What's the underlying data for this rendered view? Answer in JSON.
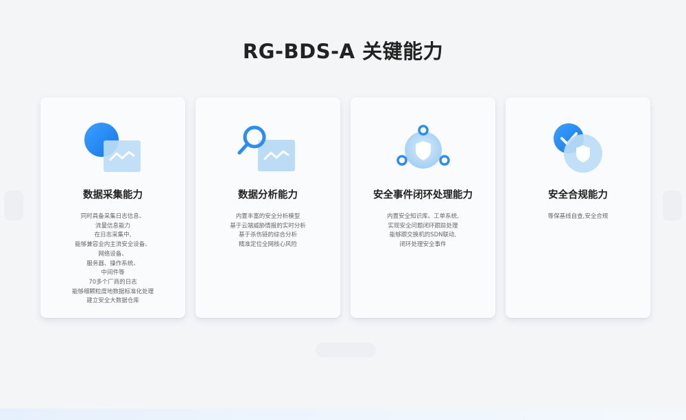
{
  "page": {
    "title": "RG-BDS-A 关键能力"
  },
  "cards": [
    {
      "title": "数据采集能力",
      "icon": "data-collection-icon",
      "desc": [
        "同时具备采集日志信息、",
        "流量信息能力",
        "在日志采集中,",
        "能够兼容业内主流安全设备、",
        "网络设备、",
        "服务器、操作系统、",
        "中间件等",
        "70多个厂商的日志",
        "能够细颗粒度地数据标准化处理",
        "建立安全大数据仓库"
      ]
    },
    {
      "title": "数据分析能力",
      "icon": "data-analysis-icon",
      "desc": [
        "内置丰富的安全分析模型",
        "基于云端威胁情报的实时分析",
        "基于杀伤链的综合分析",
        "精准定位全网核心风险"
      ]
    },
    {
      "title": "安全事件闭环处理能力",
      "icon": "security-loop-icon",
      "desc": [
        "内置安全知识库、工单系统,",
        "实现安全问题闭环跟踪处理",
        "能够跟交换机的SDN联动,",
        "闭环处理安全事件"
      ]
    },
    {
      "title": "安全合规能力",
      "icon": "compliance-shield-icon",
      "desc": [
        "等保基线自查,安全合规"
      ]
    }
  ],
  "colors": {
    "accent": "#2b8cf2",
    "light": "#b9dcf6",
    "title": "#222222",
    "body": "#666666"
  }
}
